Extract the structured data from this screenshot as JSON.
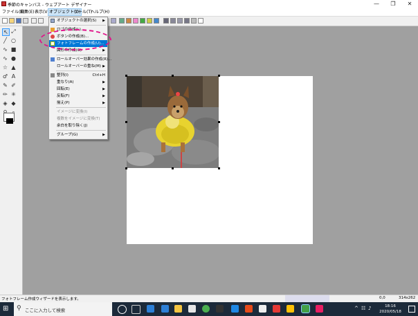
{
  "window": {
    "title": "季節のキャンバス - ウェブアート デザイナー",
    "controls": [
      "—",
      "❐",
      "✕"
    ]
  },
  "menubar": {
    "items": [
      {
        "label": "ファイル(F)",
        "active": false
      },
      {
        "label": "編集(E)",
        "active": false
      },
      {
        "label": "表示(V)",
        "active": false
      },
      {
        "label": "オブジェクト(O)",
        "active": true
      },
      {
        "label": "ツール(T)",
        "active": false
      },
      {
        "label": "ヘルプ(H)",
        "active": false
      }
    ]
  },
  "object_menu": {
    "items": [
      {
        "label": "オブジェクトの選択(S)",
        "shortcut": "",
        "submenu": true,
        "highlighted": false,
        "disabled": false
      },
      {
        "label": "ロゴの作成(L)...",
        "shortcut": "",
        "submenu": false,
        "highlighted": false,
        "disabled": false
      },
      {
        "label": "ボタンの作成(B)...",
        "shortcut": "",
        "submenu": false,
        "highlighted": false,
        "disabled": false
      },
      {
        "label": "フォトフレームの作成(U)...",
        "shortcut": "",
        "submenu": false,
        "highlighted": true,
        "disabled": false
      },
      {
        "label": "図形の作成(G)",
        "shortcut": "",
        "submenu": true,
        "highlighted": false,
        "disabled": false
      },
      {
        "label": "ロールオーバー効果の作成(R)...",
        "shortcut": "",
        "submenu": false,
        "highlighted": false,
        "disabled": false
      },
      {
        "label": "ロールオーバーの重ね(M)",
        "shortcut": "",
        "submenu": true,
        "highlighted": false,
        "disabled": false
      },
      {
        "label": "整列(I)",
        "shortcut": "Ctrl+H",
        "submenu": false,
        "highlighted": false,
        "disabled": false
      },
      {
        "label": "重なり(A)",
        "shortcut": "",
        "submenu": true,
        "highlighted": false,
        "disabled": false
      },
      {
        "label": "回転(E)",
        "shortcut": "",
        "submenu": true,
        "highlighted": false,
        "disabled": false
      },
      {
        "label": "反転(F)",
        "shortcut": "",
        "submenu": true,
        "highlighted": false,
        "disabled": false
      },
      {
        "label": "揃え(P)",
        "shortcut": "",
        "submenu": true,
        "highlighted": false,
        "disabled": false
      },
      {
        "label": "イメージに変換(I)",
        "shortcut": "",
        "submenu": false,
        "highlighted": false,
        "disabled": true
      },
      {
        "label": "複数をイメージに変換(T)",
        "shortcut": "",
        "submenu": false,
        "highlighted": false,
        "disabled": true
      },
      {
        "label": "余白を取り除く(J)",
        "shortcut": "",
        "submenu": false,
        "highlighted": false,
        "disabled": false
      },
      {
        "label": "グループ(G)",
        "shortcut": "",
        "submenu": true,
        "highlighted": false,
        "disabled": false
      }
    ]
  },
  "statusbar": {
    "message": "フォトフレーム作成ウィザードを表示します。",
    "coords": "0,0",
    "size": "314x262"
  },
  "taskbar": {
    "search_placeholder": "ここに入力して検索",
    "time": "18:16",
    "date": "2020/05/18"
  },
  "colors": {
    "accent": "#0078d7",
    "highlight_oval": "#e0138a",
    "workspace": "#a0a0a0"
  }
}
